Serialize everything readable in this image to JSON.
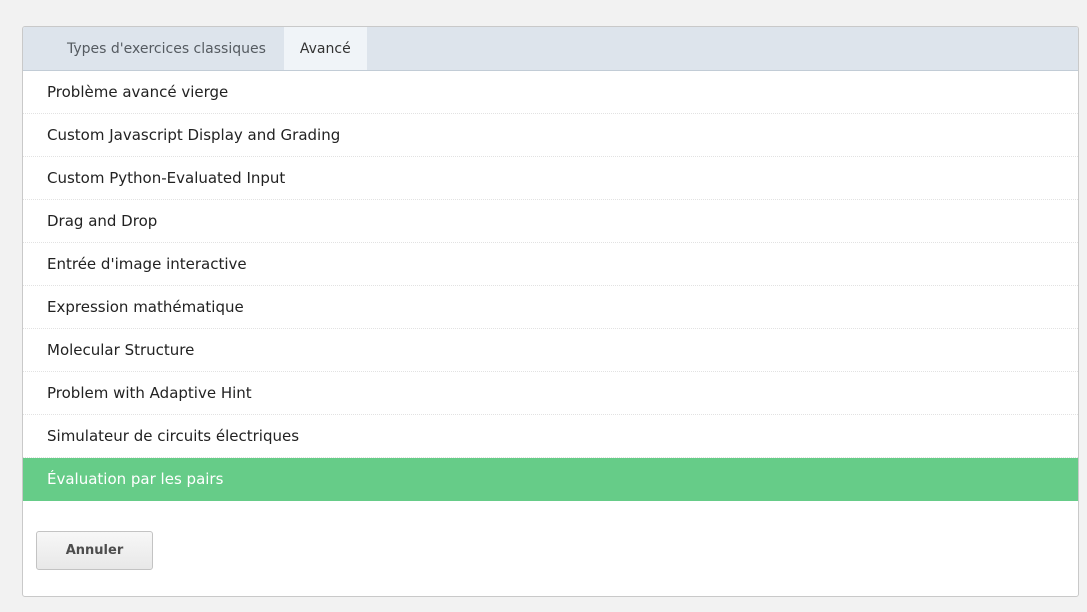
{
  "tabs": [
    {
      "label": "Types d'exercices classiques",
      "active": false
    },
    {
      "label": "Avancé",
      "active": true
    }
  ],
  "items": [
    {
      "label": "Problème avancé vierge"
    },
    {
      "label": "Custom Javascript Display and Grading"
    },
    {
      "label": "Custom Python-Evaluated Input"
    },
    {
      "label": "Drag and Drop"
    },
    {
      "label": "Entrée d'image interactive"
    },
    {
      "label": "Expression mathématique"
    },
    {
      "label": "Molecular Structure"
    },
    {
      "label": "Problem with Adaptive Hint"
    },
    {
      "label": "Simulateur de circuits électriques"
    },
    {
      "label": "Évaluation par les pairs"
    }
  ],
  "selected_item": "Évaluation par les pairs",
  "cancel_label": "Annuler",
  "colors": {
    "selected_row": "#66cc88",
    "tabbar_background": "#dde4ec"
  }
}
